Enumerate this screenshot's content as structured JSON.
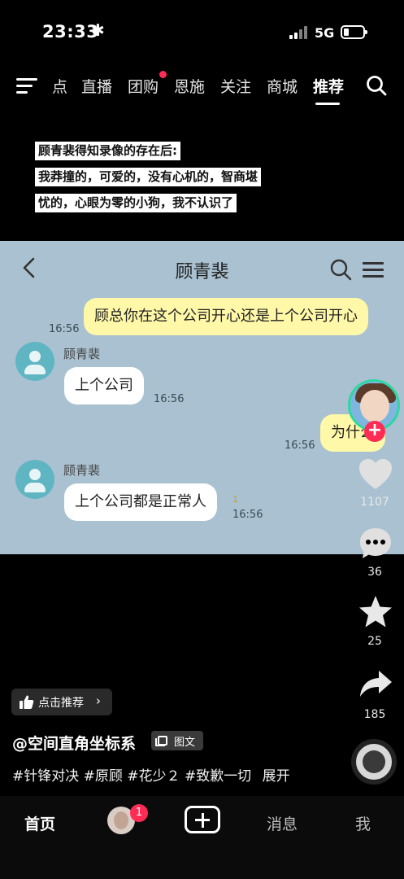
{
  "status_bar": {
    "time": "23:33",
    "time_symbol": "✱",
    "network": "5G",
    "battery_level": 0.2
  },
  "top_nav": {
    "tabs": [
      {
        "label": "点"
      },
      {
        "label": "直播"
      },
      {
        "label": "团购"
      },
      {
        "label": "恩施"
      },
      {
        "label": "关注"
      },
      {
        "label": "商城"
      },
      {
        "label": "推荐",
        "active": true
      }
    ]
  },
  "caption": {
    "lines": [
      "顾青裴得知录像的存在后:",
      "我莽撞的，可爱的，没有心机的，智商堪",
      "忧的，心眼为零的小狗，我不认识了"
    ]
  },
  "chat": {
    "title": "顾青裴",
    "messages": [
      {
        "from": "me",
        "text": "顾总你在这个公司开心还是上个公司开心",
        "time": "16:56"
      },
      {
        "from": "other",
        "sender": "顾青裴",
        "text": "上个公司",
        "time": "16:56"
      },
      {
        "from": "me",
        "text": "为什么",
        "time": "16:56"
      },
      {
        "from": "other",
        "sender": "顾青裴",
        "text": "上个公司都是正常人",
        "time": "16:56",
        "mark": "1"
      }
    ]
  },
  "rail": {
    "likes": "1107",
    "comments": "36",
    "favorites": "25",
    "shares": "185"
  },
  "post": {
    "recommend_label": "点击推荐",
    "author": "@空间直角坐标系",
    "type_label": "图文",
    "tags": "#针锋对决 #原顾 #花少２ #致歉一切",
    "expand_label": "展开"
  },
  "tab_bar": {
    "home": "首页",
    "friend_badge": "1",
    "messages": "消息",
    "me": "我"
  },
  "colors": {
    "accent": "#fe2c55",
    "chat_bg": "#a9c1d0",
    "my_bubble": "#fff8a8"
  }
}
